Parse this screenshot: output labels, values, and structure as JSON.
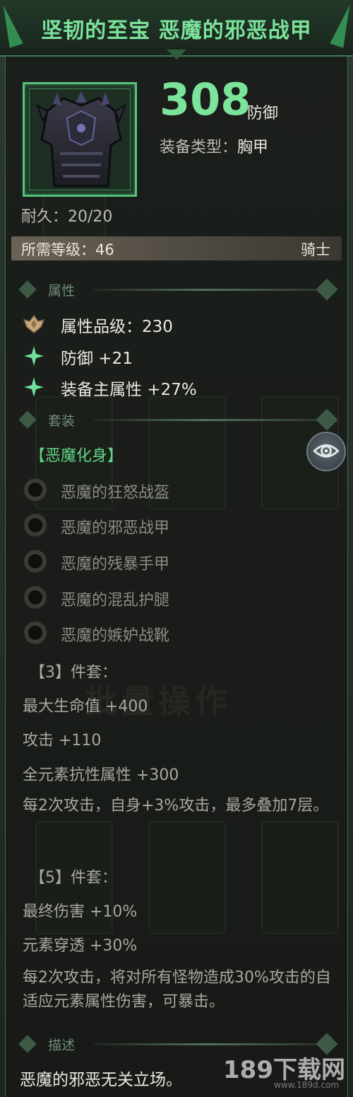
{
  "item": {
    "title": "坚韧的至宝 恶魔的邪恶战甲",
    "defense_value": "308",
    "defense_unit": "防御",
    "equip_type_label": "装备类型：",
    "equip_type_value": "胸甲",
    "durability": "耐久：20/20",
    "required_level": "所需等级：46",
    "class": "骑士",
    "icon": "demon-armor-icon"
  },
  "sections": {
    "attributes": "属性",
    "set": "套装",
    "description": "描述"
  },
  "attributes": [
    {
      "icon": "quality-crest-icon",
      "text": "属性品级：230"
    },
    {
      "icon": "sparkle-icon",
      "text": "防御 +21"
    },
    {
      "icon": "sparkle-icon",
      "text": "装备主属性 +27%"
    }
  ],
  "set": {
    "name": "【恶魔化身】",
    "pieces": [
      "恶魔的狂怒战盔",
      "恶魔的邪恶战甲",
      "恶魔的残暴手甲",
      "恶魔的混乱护腿",
      "恶魔的嫉妒战靴"
    ],
    "tier3_header": "【3】件套：",
    "tier3_bonuses": [
      "最大生命值 +400",
      "攻击 +110",
      "全元素抗性属性 +300",
      "每2次攻击，自身+3%攻击，最多叠加7层。"
    ],
    "tier5_header": "【5】件套：",
    "tier5_bonuses": [
      "最终伤害 +10%",
      "元素穿透 +30%",
      "每2次攻击，将对所有怪物造成30%攻击的自适应元素属性伤害，可暴击。"
    ]
  },
  "description": "恶魔的邪恶无关立场。",
  "background_text": "批量操作",
  "watermark": {
    "logo": "189下载网",
    "url": "www.189d.com"
  },
  "colors": {
    "accent_green": "#7be39a",
    "set_green": "#62d487",
    "frame_green": "#57c27a"
  }
}
